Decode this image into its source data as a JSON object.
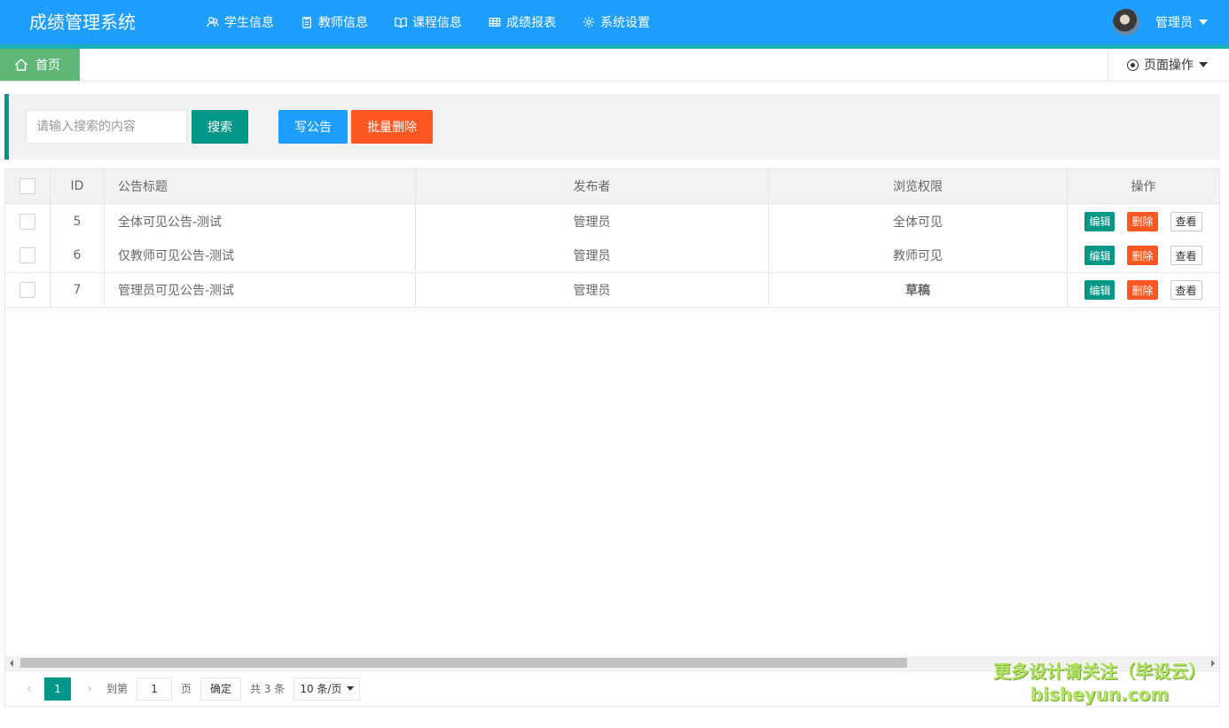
{
  "header": {
    "logo": "成绩管理系统",
    "nav": [
      {
        "label": "学生信息",
        "icon": "users-icon"
      },
      {
        "label": "教师信息",
        "icon": "clipboard-icon"
      },
      {
        "label": "课程信息",
        "icon": "book-icon"
      },
      {
        "label": "成绩报表",
        "icon": "table-icon"
      },
      {
        "label": "系统设置",
        "icon": "gear-icon"
      }
    ],
    "user": "管理员"
  },
  "tabbar": {
    "home": "首页",
    "page_ops": "页面操作"
  },
  "toolbar": {
    "search_placeholder": "请输入搜索的内容",
    "search_btn": "搜索",
    "write_btn": "写公告",
    "batch_delete_btn": "批量删除"
  },
  "table": {
    "columns": [
      "ID",
      "公告标题",
      "发布者",
      "浏览权限",
      "操作"
    ],
    "rows": [
      {
        "id": "5",
        "title": "全体可见公告-测试",
        "publisher": "管理员",
        "permission": "全体可见"
      },
      {
        "id": "6",
        "title": "仅教师可见公告-测试",
        "publisher": "管理员",
        "permission": "教师可见"
      },
      {
        "id": "7",
        "title": "管理员可见公告-测试",
        "publisher": "管理员",
        "permission": "草稿"
      }
    ],
    "actions": {
      "edit": "编辑",
      "delete": "删除",
      "view": "查看"
    }
  },
  "pager": {
    "current": "1",
    "goto_label": "到第",
    "goto_value": "1",
    "page_unit": "页",
    "confirm": "确定",
    "total": "共 3 条",
    "page_size": "10 条/页"
  },
  "watermark": {
    "line1": "更多设计请关注（毕设云）",
    "line2": "bisheyun.com"
  },
  "colors": {
    "header": "#1E9FFF",
    "primary": "#009688",
    "danger": "#FF5722",
    "home_tab": "#5fb878"
  }
}
